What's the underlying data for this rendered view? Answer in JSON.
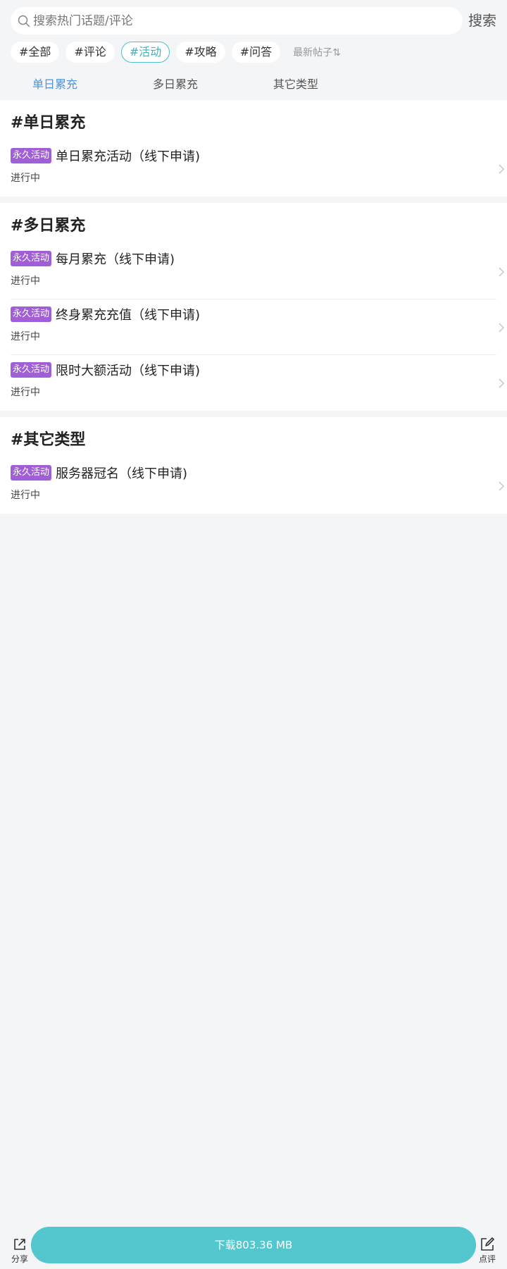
{
  "search": {
    "placeholder": "搜索热门话题/评论",
    "button_label": "搜索"
  },
  "chips": [
    {
      "label": "#全部",
      "active": false
    },
    {
      "label": "#评论",
      "active": false
    },
    {
      "label": "#活动",
      "active": true
    },
    {
      "label": "#攻略",
      "active": false
    },
    {
      "label": "#问答",
      "active": false
    }
  ],
  "sort_label": "最新帖子⇅",
  "tabs": [
    {
      "label": "单日累充",
      "active": true
    },
    {
      "label": "多日累充",
      "active": false
    },
    {
      "label": "其它类型",
      "active": false
    }
  ],
  "sections": [
    {
      "title": "#单日累充",
      "items": [
        {
          "badge": "永久活动",
          "title": "单日累充活动（线下申请)",
          "status": "进行中"
        }
      ]
    },
    {
      "title": "#多日累充",
      "items": [
        {
          "badge": "永久活动",
          "title": "每月累充（线下申请)",
          "status": "进行中"
        },
        {
          "badge": "永久活动",
          "title": "终身累充充值（线下申请)",
          "status": "进行中"
        },
        {
          "badge": "永久活动",
          "title": "限时大额活动（线下申请)",
          "status": "进行中"
        }
      ]
    },
    {
      "title": "#其它类型",
      "items": [
        {
          "badge": "永久活动",
          "title": "服务器冠名（线下申请)",
          "status": "进行中"
        }
      ]
    }
  ],
  "bottom_bar": {
    "share_label": "分享",
    "download_label": "下载803.36 MB",
    "review_label": "点评"
  },
  "colors": {
    "accent": "#54c6cd",
    "active_chip": "#3bb3c2",
    "active_tab": "#4e93d8",
    "badge": "#a05fd6",
    "background": "#f4f5f7"
  }
}
